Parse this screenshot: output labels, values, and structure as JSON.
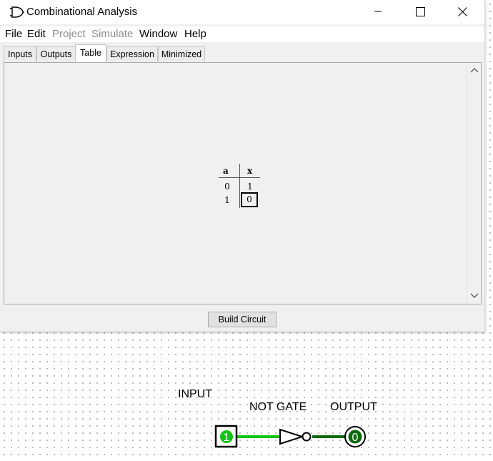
{
  "window": {
    "title": "Combinational Analysis"
  },
  "menu": [
    {
      "label": "File",
      "enabled": true
    },
    {
      "label": "Edit",
      "enabled": true
    },
    {
      "label": "Project",
      "enabled": false
    },
    {
      "label": "Simulate",
      "enabled": false
    },
    {
      "label": "Window",
      "enabled": true
    },
    {
      "label": "Help",
      "enabled": true
    }
  ],
  "tabs": [
    {
      "label": "Inputs",
      "active": false
    },
    {
      "label": "Outputs",
      "active": false
    },
    {
      "label": "Table",
      "active": true
    },
    {
      "label": "Expression",
      "active": false
    },
    {
      "label": "Minimized",
      "active": false
    }
  ],
  "truth_table": {
    "headers": [
      "a",
      "x"
    ],
    "rows": [
      [
        "0",
        "1"
      ],
      [
        "1",
        "0"
      ]
    ],
    "selected_cell": "row 2, column x"
  },
  "build_button": "Build Circuit",
  "canvas": {
    "labels": {
      "input": "INPUT",
      "gate": "NOT GATE",
      "output": "OUTPUT"
    },
    "input_value": "1",
    "output_value": "0",
    "colors": {
      "wire_high": "#13c313",
      "wire_low": "#0c6a0c",
      "pin_value": "#13c313",
      "selection": "#000000"
    }
  }
}
